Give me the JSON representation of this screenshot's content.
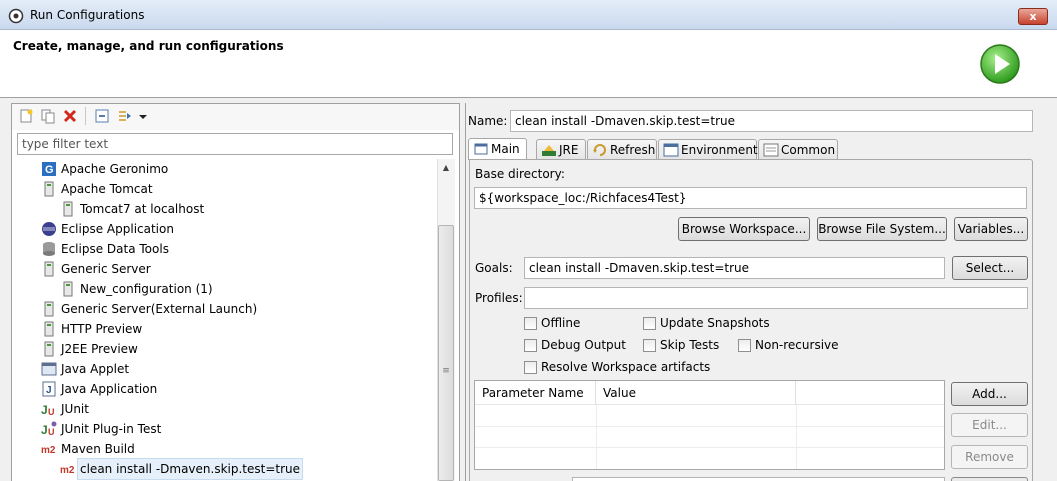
{
  "window": {
    "title": "Run Configurations",
    "close_label": "x"
  },
  "banner": {
    "title": "Create, manage, and run configurations"
  },
  "filter": {
    "placeholder": "type filter text"
  },
  "tree": {
    "items": [
      {
        "label": "Apache Geronimo",
        "icon": "geronimo-icon"
      },
      {
        "label": "Apache Tomcat",
        "icon": "server-icon"
      },
      {
        "label": "Tomcat7 at localhost",
        "icon": "server-icon"
      },
      {
        "label": "Eclipse Application",
        "icon": "eclipse-icon"
      },
      {
        "label": "Eclipse Data Tools",
        "icon": "database-icon"
      },
      {
        "label": "Generic Server",
        "icon": "server-icon"
      },
      {
        "label": "New_configuration (1)",
        "icon": "server-icon"
      },
      {
        "label": "Generic Server(External Launch)",
        "icon": "server-icon"
      },
      {
        "label": "HTTP Preview",
        "icon": "server-icon"
      },
      {
        "label": "J2EE Preview",
        "icon": "server-icon"
      },
      {
        "label": "Java Applet",
        "icon": "java-applet-icon"
      },
      {
        "label": "Java Application",
        "icon": "java-application-icon"
      },
      {
        "label": "JUnit",
        "icon": "junit-icon"
      },
      {
        "label": "JUnit Plug-in Test",
        "icon": "junit-plugin-icon"
      },
      {
        "label": "Maven Build",
        "icon": "maven-icon"
      },
      {
        "label": "clean install -Dmaven.skip.test=true",
        "icon": "maven-icon"
      }
    ]
  },
  "config": {
    "name_label": "Name:",
    "name_value": "clean install -Dmaven.skip.test=true",
    "tabs": [
      {
        "label": "Main",
        "icon": "main-tab-icon"
      },
      {
        "label": "JRE",
        "icon": "jre-icon"
      },
      {
        "label": "Refresh",
        "icon": "refresh-icon"
      },
      {
        "label": "Environment",
        "icon": "environment-icon"
      },
      {
        "label": "Common",
        "icon": "common-icon"
      }
    ],
    "base_dir_label": "Base directory:",
    "base_dir_value": "${workspace_loc:/Richfaces4Test}",
    "browse_workspace": "Browse Workspace...",
    "browse_fs": "Browse File System...",
    "variables": "Variables...",
    "goals_label": "Goals:",
    "goals_value": "clean install -Dmaven.skip.test=true",
    "select": "Select...",
    "profiles_label": "Profiles:",
    "profiles_value": "",
    "checks": {
      "offline": "Offline",
      "update_snapshots": "Update Snapshots",
      "debug_output": "Debug Output",
      "skip_tests": "Skip Tests",
      "non_recursive": "Non-recursive",
      "resolve_workspace": "Resolve Workspace artifacts"
    },
    "param_columns": [
      "Parameter Name",
      "Value"
    ],
    "add": "Add...",
    "edit": "Edit...",
    "remove": "Remove"
  },
  "colors": {
    "accent_selection": "#e6f0fa",
    "maven": "#c0392b",
    "close_button": "#c7432f"
  }
}
